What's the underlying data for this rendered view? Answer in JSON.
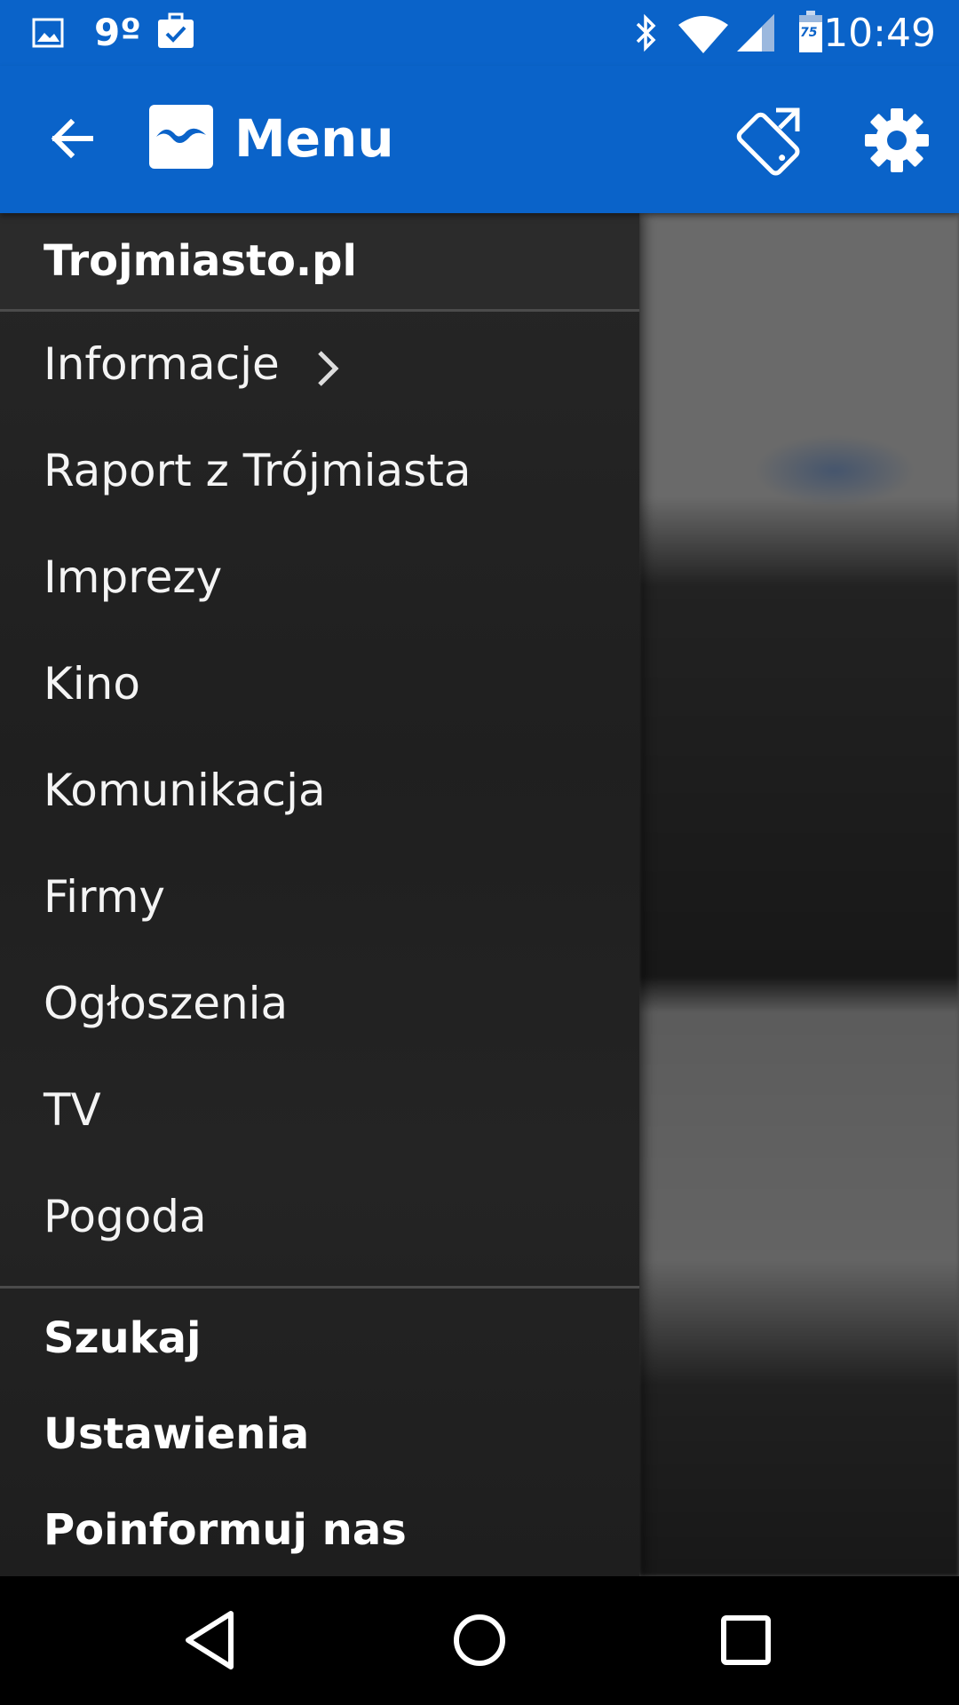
{
  "status_bar": {
    "temperature": "9º",
    "battery_level": "75",
    "time": "10:49",
    "icons": [
      "image-notification-icon",
      "work-notification-icon",
      "bluetooth-icon",
      "wifi-icon",
      "cell-signal-icon",
      "battery-icon"
    ]
  },
  "app_bar": {
    "title": "Menu",
    "color": "#0a63c9",
    "icons": [
      "back-arrow-icon",
      "app-logo-icon",
      "rotate-screen-icon",
      "settings-gear-icon"
    ]
  },
  "drawer": {
    "header": "Trojmiasto.pl",
    "items": [
      {
        "label": "Informacje",
        "has_submenu": true
      },
      {
        "label": "Raport z Trójmiasta"
      },
      {
        "label": "Imprezy"
      },
      {
        "label": "Kino"
      },
      {
        "label": "Komunikacja"
      },
      {
        "label": "Firmy"
      },
      {
        "label": "Ogłoszenia"
      },
      {
        "label": "TV"
      },
      {
        "label": "Pogoda"
      }
    ],
    "footer": [
      {
        "label": "Szukaj"
      },
      {
        "label": "Ustawienia"
      },
      {
        "label": "Poinformuj nas"
      }
    ]
  },
  "nav_bar": {
    "icons": [
      "nav-back-icon",
      "nav-home-icon",
      "nav-recents-icon"
    ]
  }
}
